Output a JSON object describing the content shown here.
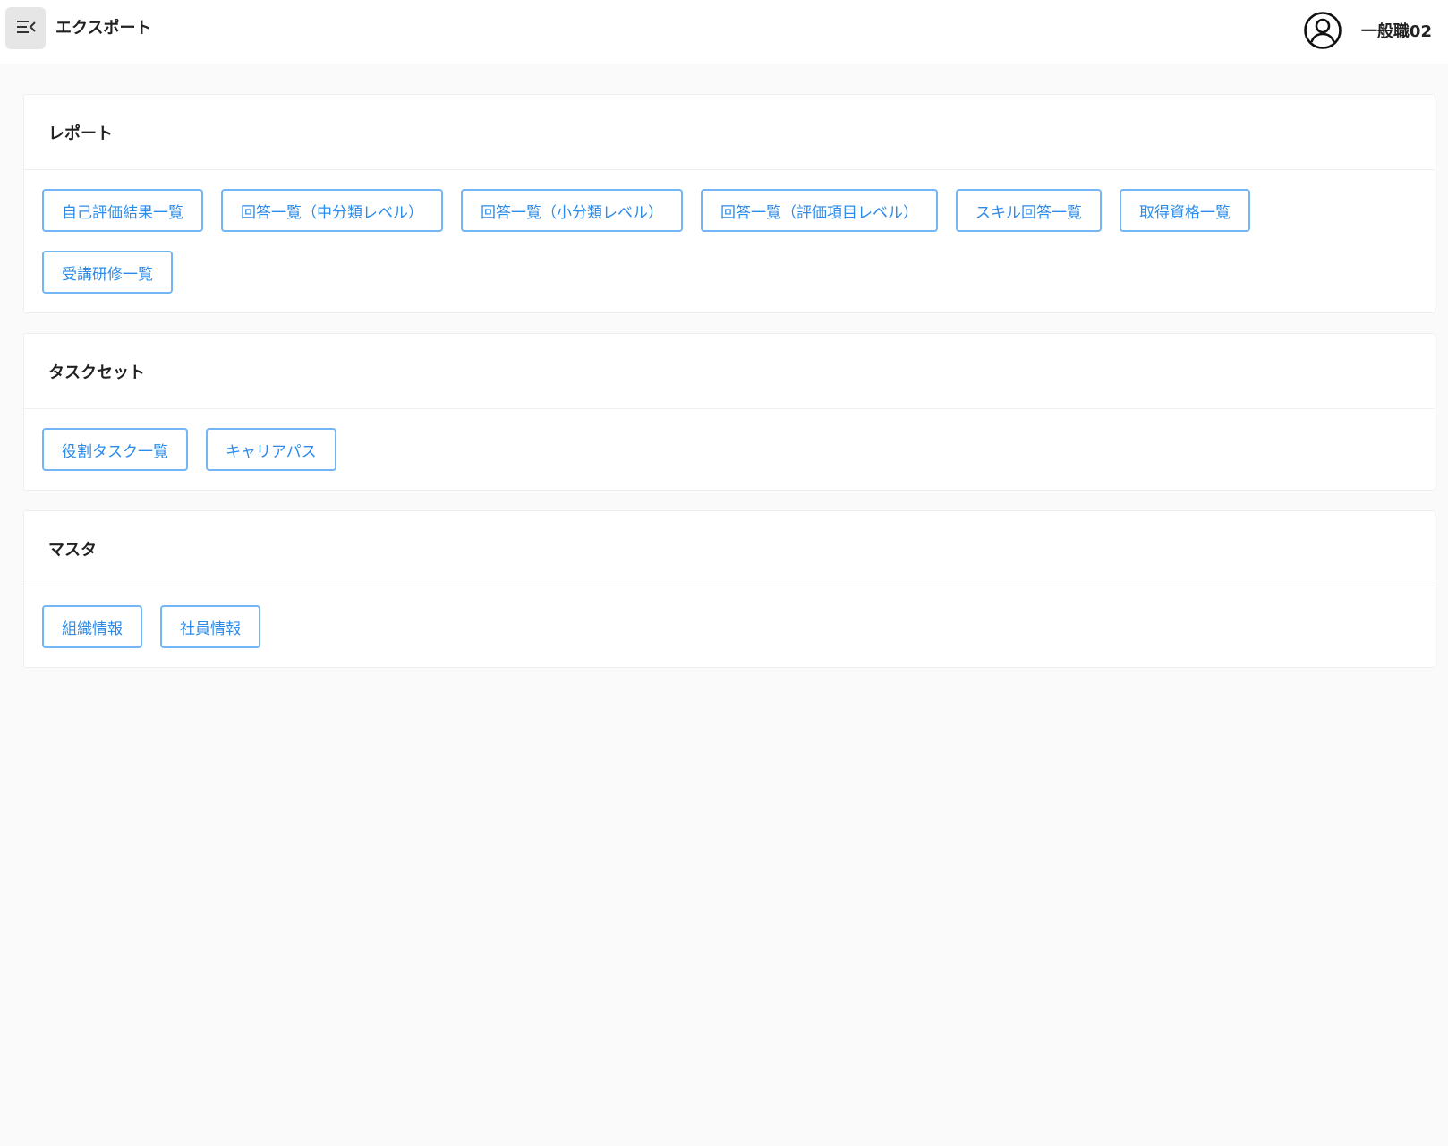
{
  "header": {
    "title": "エクスポート",
    "menu_icon": "menu-collapse-icon",
    "user_icon": "user-circle-icon",
    "user_name": "一般職02"
  },
  "colors": {
    "accent": "#2d8ce9",
    "button_border": "#74b6f5",
    "background": "#fafafa",
    "card": "#ffffff"
  },
  "sections": [
    {
      "title": "レポート",
      "buttons": [
        "自己評価結果一覧",
        "回答一覧（中分類レベル）",
        "回答一覧（小分類レベル）",
        "回答一覧（評価項目レベル）",
        "スキル回答一覧",
        "取得資格一覧",
        "受講研修一覧"
      ]
    },
    {
      "title": "タスクセット",
      "buttons": [
        "役割タスク一覧",
        "キャリアパス"
      ]
    },
    {
      "title": "マスタ",
      "buttons": [
        "組織情報",
        "社員情報"
      ]
    }
  ]
}
